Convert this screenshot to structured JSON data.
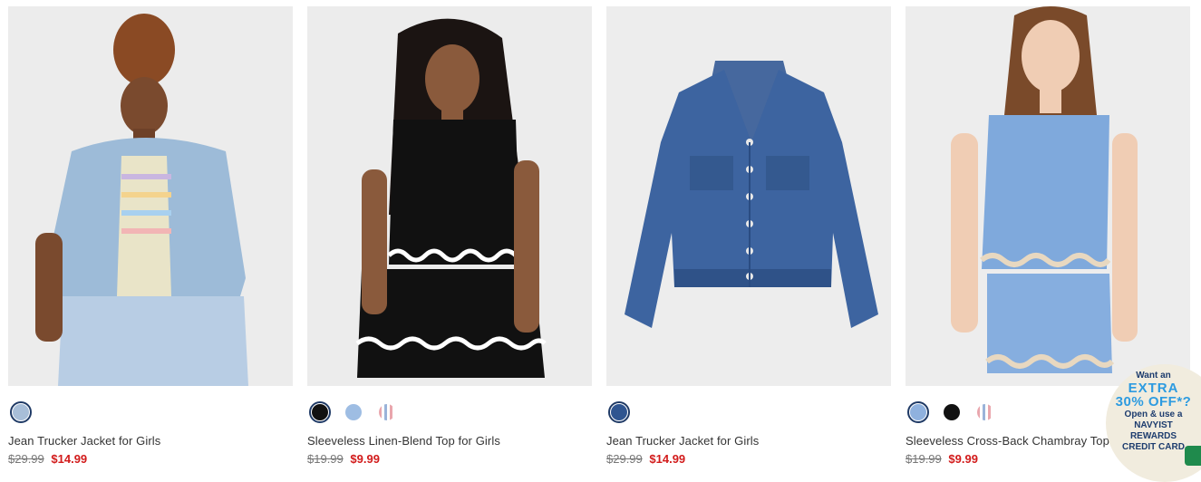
{
  "products": [
    {
      "name": "Jean Trucker Jacket for Girls",
      "was_price": "$29.99",
      "sale_price": "$14.99",
      "image_alt": "Girl in light-wash jean trucker jacket",
      "swatches": [
        {
          "color": "#a8bed8",
          "selected": true
        }
      ]
    },
    {
      "name": "Sleeveless Linen-Blend Top for Girls",
      "was_price": "$19.99",
      "sale_price": "$9.99",
      "image_alt": "Girl in black sleeveless top with rick-rack trim",
      "swatches": [
        {
          "color": "#111111",
          "selected": true
        },
        {
          "color": "#9ebde3",
          "selected": false
        },
        {
          "color": "stripe",
          "selected": false
        }
      ]
    },
    {
      "name": "Jean Trucker Jacket for Girls",
      "was_price": "$29.99",
      "sale_price": "$14.99",
      "image_alt": "Medium-wash jean trucker jacket flat lay",
      "swatches": [
        {
          "color": "#2f5590",
          "selected": true
        }
      ]
    },
    {
      "name": "Sleeveless Cross-Back Chambray Top for Girls",
      "was_price": "$19.99",
      "sale_price": "$9.99",
      "image_alt": "Girl in chambray sleeveless top and shorts",
      "swatches": [
        {
          "color": "#8fb1de",
          "selected": true
        },
        {
          "color": "#111111",
          "selected": false
        },
        {
          "color": "stripe",
          "selected": false
        }
      ]
    }
  ],
  "promo": {
    "line1": "Want an",
    "line2": "EXTRA",
    "line3": "30% OFF*?",
    "line4": "Open & use a",
    "line5": "NAVYIST",
    "line6": "REWARDS",
    "line7": "CREDIT CARD"
  },
  "colors": {
    "sale": "#d21b1b",
    "navy": "#1f3a66",
    "promo_blue": "#2d9be0"
  }
}
